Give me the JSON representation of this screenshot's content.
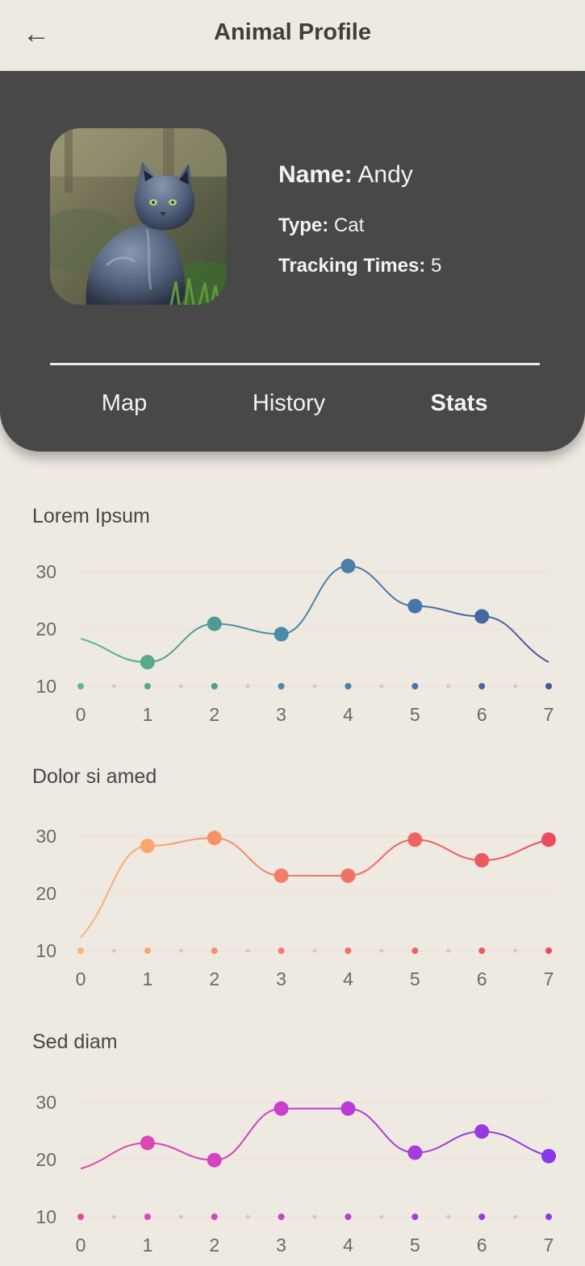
{
  "header": {
    "back_icon": "←",
    "title": "Animal Profile"
  },
  "profile": {
    "name_label": "Name:",
    "name_value": "Andy",
    "type_label": "Type:",
    "type_value": "Cat",
    "tracking_label": "Tracking Times:",
    "tracking_value": "5"
  },
  "tabs": [
    {
      "label": "Map",
      "active": false
    },
    {
      "label": "History",
      "active": false
    },
    {
      "label": "Stats",
      "active": true
    }
  ],
  "chart_data": [
    {
      "type": "line",
      "title": "Lorem Ipsum",
      "x": [
        0,
        1,
        2,
        3,
        4,
        5,
        6,
        7
      ],
      "ylim": [
        10,
        30
      ],
      "yticks": [
        10,
        20,
        30
      ],
      "series": [
        {
          "values": [
            18.3,
            14.2,
            20.9,
            19.1,
            31.0,
            24.0,
            22.2,
            14.2
          ]
        }
      ],
      "colors": [
        "#5DB88A",
        "#55A98D",
        "#4E999A",
        "#4A8BA6",
        "#4A80A8",
        "#4675A8",
        "#4568A3",
        "#44589A"
      ],
      "smooth": true
    },
    {
      "type": "line",
      "title": "Dolor si amed",
      "x": [
        0,
        1,
        2,
        3,
        4,
        5,
        6,
        7
      ],
      "ylim": [
        10,
        30
      ],
      "yticks": [
        10,
        20,
        30
      ],
      "series": [
        {
          "values": [
            12.3,
            28.3,
            29.7,
            23.1,
            23.1,
            29.4,
            25.8,
            29.4
          ]
        }
      ],
      "colors": [
        "#F9B777",
        "#F8A772",
        "#F4926B",
        "#F28068",
        "#F07265",
        "#EE6462",
        "#EE5A60",
        "#EC4A5E"
      ],
      "smooth": true
    },
    {
      "type": "line",
      "title": "Sed diam",
      "x": [
        0,
        1,
        2,
        3,
        4,
        5,
        6,
        7
      ],
      "ylim": [
        10,
        30
      ],
      "yticks": [
        10,
        20,
        30
      ],
      "series": [
        {
          "values": [
            18.4,
            22.9,
            19.9,
            28.9,
            28.9,
            21.2,
            24.9,
            20.6
          ]
        }
      ],
      "colors": [
        "#E24AAF",
        "#DE47B6",
        "#D743BE",
        "#CA3FCB",
        "#BA3CD4",
        "#A83BDE",
        "#9839E4",
        "#8A38EA"
      ],
      "smooth": true
    }
  ]
}
